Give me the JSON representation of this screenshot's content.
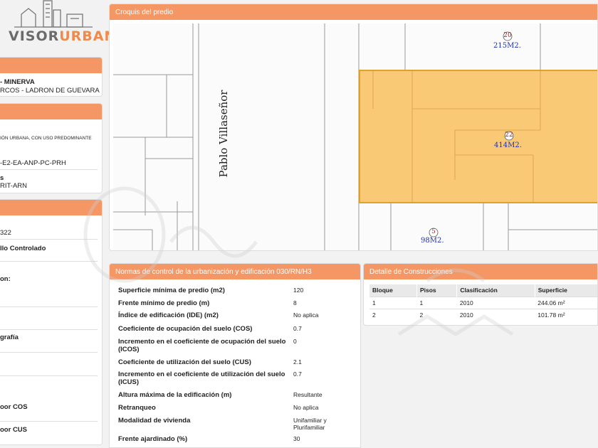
{
  "logo": {
    "part1": "VISOR",
    "part2": "URBANO"
  },
  "location_panel": {
    "line1": "- MINERVA",
    "line2": "RCOS - LADRON DE GUEVARA"
  },
  "zoning_panel": {
    "use_text": "IÓN URBANA, CON USO PREDOMINANTE",
    "code": "-E2-EA-ANP-PC-PRH",
    "label": "s",
    "sub": "RIT-ARN"
  },
  "control_panel": {
    "number": "322",
    "status": "llo Controlado",
    "items": [
      "on:",
      "grafía",
      "oor COS",
      "oor CUS"
    ]
  },
  "croquis": {
    "title": "Croquis del predio",
    "street": "Pablo Villaseñor",
    "lots": [
      {
        "num": "20",
        "area": "215M2."
      },
      {
        "num": "22",
        "area": "414M2."
      },
      {
        "num": "5",
        "area": "98M2."
      }
    ],
    "highlight_color": "#f8c46a"
  },
  "normas": {
    "title": "Normas de control de la urbanización y edificación 030/RN/H3",
    "rows": [
      {
        "label": "Superficie mínima de predio (m2)",
        "value": "120"
      },
      {
        "label": "Frente mínimo de predio (m)",
        "value": "8"
      },
      {
        "label": "Índice de edificación (IDE) (m2)",
        "value": "No aplica"
      },
      {
        "label": "Coeficiente de ocupación del suelo (COS)",
        "value": "0.7"
      },
      {
        "label": "Incremento en el coeficiente de ocupación del suelo (ICOS)",
        "value": "0"
      },
      {
        "label": "Coeficiente de utilización del suelo (CUS)",
        "value": "2.1"
      },
      {
        "label": "Incremento en el coeficiente de utilización del suelo (ICUS)",
        "value": "0.7"
      },
      {
        "label": "Altura máxima de la edificación (m)",
        "value": "Resultante"
      },
      {
        "label": "Retranqueo",
        "value": "No aplica"
      },
      {
        "label": "Modalidad de vivienda",
        "value": "Unifamiliar y Plurifamiliar"
      },
      {
        "label": "Frente ajardinado (%)",
        "value": "30"
      }
    ]
  },
  "detalle": {
    "title": "Detalle de Construcciones",
    "headers": [
      "Bloque",
      "Pisos",
      "Clasificación",
      "Superficie"
    ],
    "rows": [
      [
        "1",
        "1",
        "2010",
        "244.06 m²"
      ],
      [
        "2",
        "2",
        "2010",
        "101.78 m²"
      ]
    ]
  },
  "colors": {
    "accent": "#f59665",
    "lot_outline": "#e0a030"
  }
}
